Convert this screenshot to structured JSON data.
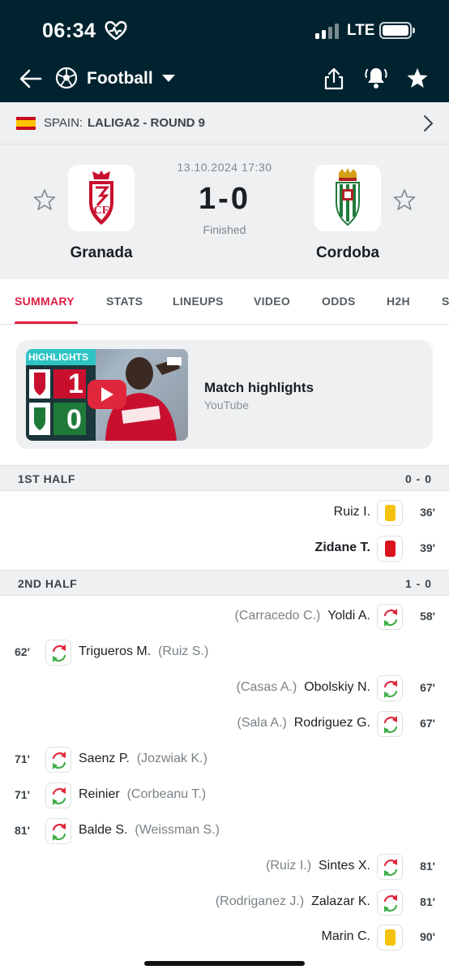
{
  "status_bar": {
    "time": "06:34",
    "network": "LTE"
  },
  "header": {
    "title": "Football",
    "icons": [
      "back-arrow-icon",
      "football-icon",
      "share-icon",
      "bell-icon",
      "star-icon"
    ]
  },
  "league": {
    "country": "SPAIN:",
    "name": "LALIGA2 - ROUND 9"
  },
  "match": {
    "datetime": "13.10.2024 17:30",
    "score": "1-0",
    "status": "Finished",
    "home": {
      "name": "Granada"
    },
    "away": {
      "name": "Cordoba"
    }
  },
  "tabs": [
    "SUMMARY",
    "STATS",
    "LINEUPS",
    "VIDEO",
    "ODDS",
    "H2H",
    "S"
  ],
  "highlights": {
    "badge": "HIGHLIGHTS",
    "title": "Match highlights",
    "source": "YouTube",
    "home_goals": "1",
    "away_goals": "0"
  },
  "halves": [
    {
      "label": "1ST HALF",
      "score": "0 - 0"
    },
    {
      "label": "2ND HALF",
      "score": "1 - 0"
    }
  ],
  "events": [
    {
      "side": "away",
      "minute": "36'",
      "type": "yellow-card",
      "player": "Ruiz I.",
      "assist": ""
    },
    {
      "side": "away",
      "minute": "39'",
      "type": "red-card",
      "player": "Zidane T.",
      "assist": ""
    },
    {
      "side": "away",
      "minute": "58'",
      "type": "substitution",
      "player": "Yoldi A.",
      "assist": "(Carracedo C.)"
    },
    {
      "side": "home",
      "minute": "62'",
      "type": "substitution",
      "player": "Trigueros M.",
      "assist": "(Ruiz S.)"
    },
    {
      "side": "away",
      "minute": "67'",
      "type": "substitution",
      "player": "Obolskiy N.",
      "assist": "(Casas A.)"
    },
    {
      "side": "away",
      "minute": "67'",
      "type": "substitution",
      "player": "Rodriguez G.",
      "assist": "(Sala A.)"
    },
    {
      "side": "home",
      "minute": "71'",
      "type": "substitution",
      "player": "Saenz P.",
      "assist": "(Jozwiak K.)"
    },
    {
      "side": "home",
      "minute": "71'",
      "type": "substitution",
      "player": "Reinier",
      "assist": "(Corbeanu T.)"
    },
    {
      "side": "home",
      "minute": "81'",
      "type": "substitution",
      "player": "Balde S.",
      "assist": "(Weissman S.)"
    },
    {
      "side": "away",
      "minute": "81'",
      "type": "substitution",
      "player": "Sintes X.",
      "assist": "(Ruiz I.)"
    },
    {
      "side": "away",
      "minute": "81'",
      "type": "substitution",
      "player": "Zalazar K.",
      "assist": "(Rodriganez J.)"
    },
    {
      "side": "away",
      "minute": "90'",
      "type": "yellow-card",
      "player": "Marin C.",
      "assist": ""
    }
  ],
  "colors": {
    "header_bg": "#00232f",
    "accent": "#de1f45",
    "yellow_card": "#f4c20d",
    "red_card": "#d9141f",
    "sub_green": "#3fae49",
    "sub_red": "#e0263b"
  }
}
